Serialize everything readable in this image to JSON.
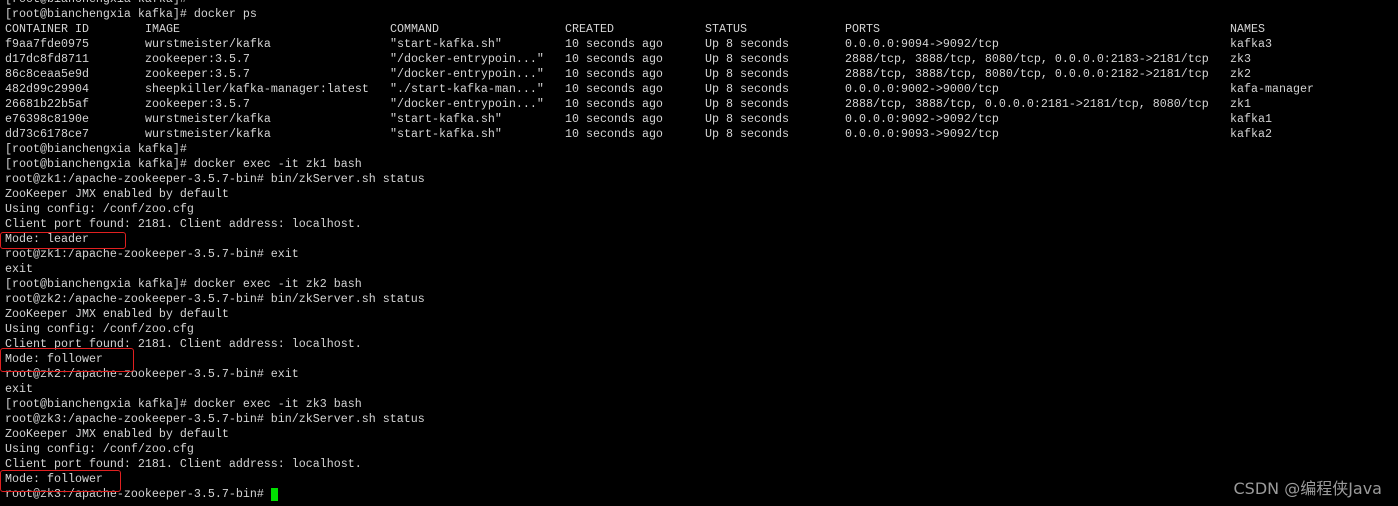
{
  "pre_lines": [
    "[root@bianchengxia kafka]#",
    "[root@bianchengxia kafka]# docker ps"
  ],
  "docker_ps": {
    "headers": [
      "CONTAINER ID",
      "IMAGE",
      "COMMAND",
      "CREATED",
      "STATUS",
      "PORTS",
      "NAMES"
    ],
    "rows": [
      [
        "f9aa7fde0975",
        "wurstmeister/kafka",
        "\"start-kafka.sh\"",
        "10 seconds ago",
        "Up 8 seconds",
        "0.0.0.0:9094->9092/tcp",
        "kafka3"
      ],
      [
        "d17dc8fd8711",
        "zookeeper:3.5.7",
        "\"/docker-entrypoin...\"",
        "10 seconds ago",
        "Up 8 seconds",
        "2888/tcp, 3888/tcp, 8080/tcp, 0.0.0.0:2183->2181/tcp",
        "zk3"
      ],
      [
        "86c8ceaa5e9d",
        "zookeeper:3.5.7",
        "\"/docker-entrypoin...\"",
        "10 seconds ago",
        "Up 8 seconds",
        "2888/tcp, 3888/tcp, 8080/tcp, 0.0.0.0:2182->2181/tcp",
        "zk2"
      ],
      [
        "482d99c29904",
        "sheepkiller/kafka-manager:latest",
        "\"./start-kafka-man...\"",
        "10 seconds ago",
        "Up 8 seconds",
        "0.0.0.0:9002->9000/tcp",
        "kafa-manager"
      ],
      [
        "26681b22b5af",
        "zookeeper:3.5.7",
        "\"/docker-entrypoin...\"",
        "10 seconds ago",
        "Up 8 seconds",
        "2888/tcp, 3888/tcp, 0.0.0.0:2181->2181/tcp, 8080/tcp",
        "zk1"
      ],
      [
        "e76398c8190e",
        "wurstmeister/kafka",
        "\"start-kafka.sh\"",
        "10 seconds ago",
        "Up 8 seconds",
        "0.0.0.0:9092->9092/tcp",
        "kafka1"
      ],
      [
        "dd73c6178ce7",
        "wurstmeister/kafka",
        "\"start-kafka.sh\"",
        "10 seconds ago",
        "Up 8 seconds",
        "0.0.0.0:9093->9092/tcp",
        "kafka2"
      ]
    ]
  },
  "post_lines": [
    "[root@bianchengxia kafka]#",
    "[root@bianchengxia kafka]# docker exec -it zk1 bash",
    "root@zk1:/apache-zookeeper-3.5.7-bin# bin/zkServer.sh status",
    "ZooKeeper JMX enabled by default",
    "Using config: /conf/zoo.cfg",
    "Client port found: 2181. Client address: localhost.",
    "Mode: leader",
    "root@zk1:/apache-zookeeper-3.5.7-bin# exit",
    "exit",
    "[root@bianchengxia kafka]# docker exec -it zk2 bash",
    "root@zk2:/apache-zookeeper-3.5.7-bin# bin/zkServer.sh status",
    "ZooKeeper JMX enabled by default",
    "Using config: /conf/zoo.cfg",
    "Client port found: 2181. Client address: localhost.",
    "Mode: follower",
    "root@zk2:/apache-zookeeper-3.5.7-bin# exit",
    "exit",
    "[root@bianchengxia kafka]# docker exec -it zk3 bash",
    "root@zk3:/apache-zookeeper-3.5.7-bin# bin/zkServer.sh status",
    "ZooKeeper JMX enabled by default",
    "Using config: /conf/zoo.cfg",
    "Client port found: 2181. Client address: localhost.",
    "Mode: follower",
    "root@zk3:/apache-zookeeper-3.5.7-bin# "
  ],
  "watermark": "CSDN @编程侠Java",
  "colors": {
    "text": "#d4d4d4",
    "background": "#000000",
    "highlight_box": "#e02020",
    "cursor": "#00e000"
  }
}
